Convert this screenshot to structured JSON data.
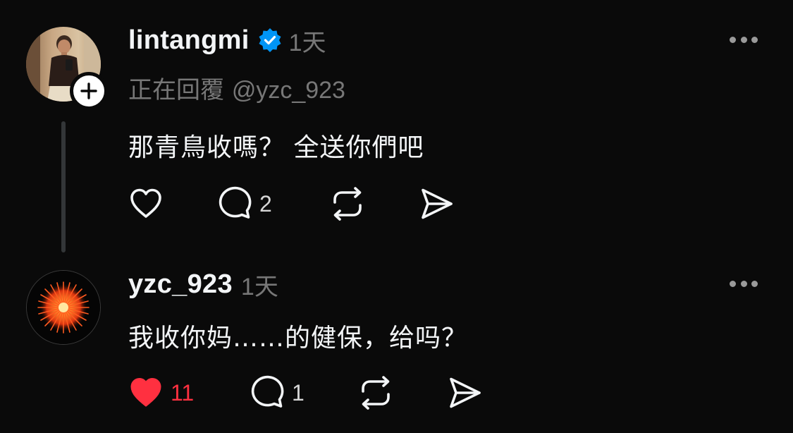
{
  "colors": {
    "background": "#0a0a0a",
    "primary_text": "#f3f5f7",
    "secondary_text": "#777777",
    "verified_blue": "#0095f6",
    "like_red": "#ff3040",
    "thread_line": "#333638"
  },
  "posts": [
    {
      "username": "lintangmi",
      "verified": true,
      "time": "1天",
      "reply_to_label": "正在回覆",
      "reply_to_handle": "@yzc_923",
      "text": "那青鳥收嗎？  全送你們吧",
      "avatar_icon": "profile-photo",
      "follow_badge": "+",
      "liked": false,
      "like_count": "",
      "comment_count": "2",
      "icons": [
        "heart-icon",
        "comment-icon",
        "repost-icon",
        "share-icon",
        "more-icon"
      ]
    },
    {
      "username": "yzc_923",
      "verified": false,
      "time": "1天",
      "text": "我收你妈……的健保，给吗？",
      "avatar_icon": "firework-image",
      "liked": true,
      "like_count": "11",
      "comment_count": "1",
      "icons": [
        "heart-filled-icon",
        "comment-icon",
        "repost-icon",
        "share-icon",
        "more-icon"
      ]
    }
  ]
}
